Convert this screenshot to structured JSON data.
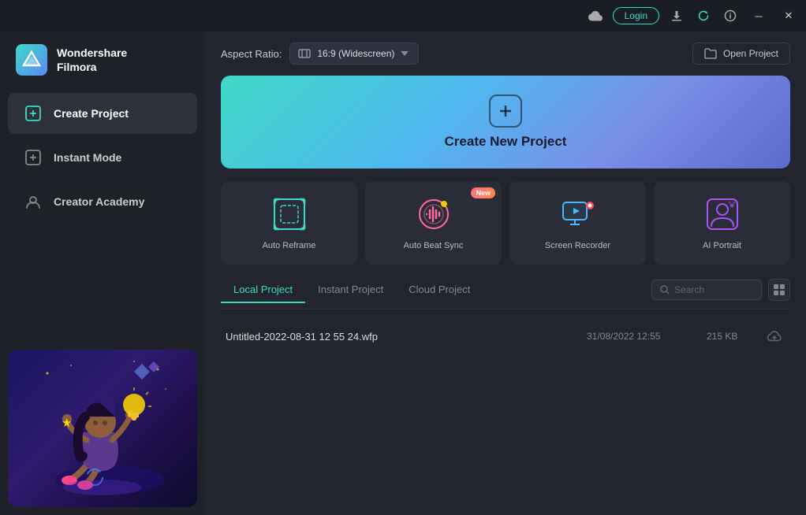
{
  "titlebar": {
    "login_label": "Login",
    "minimize_label": "─",
    "close_label": "✕"
  },
  "sidebar": {
    "logo_line1": "Wondershare",
    "logo_line2": "Filmora",
    "nav_items": [
      {
        "id": "create-project",
        "label": "Create Project",
        "active": true
      },
      {
        "id": "instant-mode",
        "label": "Instant Mode",
        "active": false
      },
      {
        "id": "creator-academy",
        "label": "Creator Academy",
        "active": false
      }
    ]
  },
  "content": {
    "aspect_ratio_label": "Aspect Ratio:",
    "aspect_ratio_value": "16:9 (Widescreen)",
    "open_project_label": "Open Project",
    "create_new_project_label": "Create New Project",
    "quick_actions": [
      {
        "id": "auto-reframe",
        "label": "Auto Reframe",
        "is_new": false
      },
      {
        "id": "auto-beat-sync",
        "label": "Auto Beat Sync",
        "is_new": true
      },
      {
        "id": "screen-recorder",
        "label": "Screen Recorder",
        "is_new": false
      },
      {
        "id": "ai-portrait",
        "label": "AI Portrait",
        "is_new": false
      }
    ],
    "project_tabs": [
      {
        "id": "local",
        "label": "Local Project",
        "active": true
      },
      {
        "id": "instant",
        "label": "Instant Project",
        "active": false
      },
      {
        "id": "cloud",
        "label": "Cloud Project",
        "active": false
      }
    ],
    "search_placeholder": "Search",
    "new_badge_label": "New",
    "projects": [
      {
        "name": "Untitled-2022-08-31 12 55 24.wfp",
        "date": "31/08/2022 12:55",
        "size": "215 KB"
      }
    ]
  }
}
